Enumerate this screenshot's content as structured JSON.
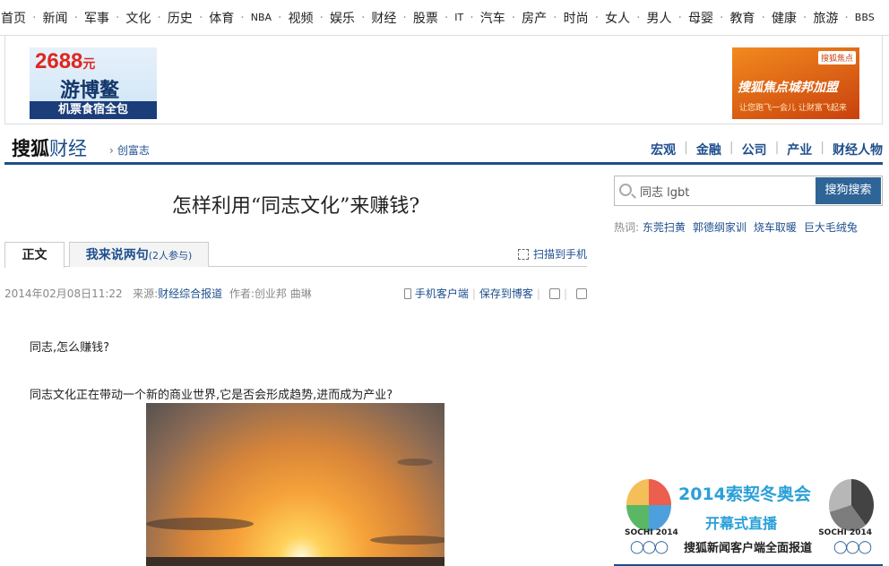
{
  "top_nav": [
    "首页",
    "新闻",
    "军事",
    "文化",
    "历史",
    "体育",
    "NBA",
    "视频",
    "娱乐",
    "财经",
    "股票",
    "IT",
    "汽车",
    "房产",
    "时尚",
    "女人",
    "男人",
    "母婴",
    "教育",
    "健康",
    "旅游",
    "BBS"
  ],
  "ads": {
    "left": {
      "price": "2688",
      "unit": "元",
      "name": "游博鳌",
      "strip": "机票食宿全包"
    },
    "right": {
      "logo": "搜狐焦点",
      "slogan": "搜狐焦点城邦加盟",
      "sub": "让您跑飞一会儿 让财富飞起来"
    }
  },
  "channel": {
    "brand_main": "搜狐",
    "brand_accent": "财经",
    "crumb_chevron": "›",
    "crumb": "创富志",
    "menu": [
      "宏观",
      "金融",
      "公司",
      "产业",
      "财经人物"
    ]
  },
  "article": {
    "title": "怎样利用“同志文化”来赚钱?",
    "tab_active": "正文",
    "tab_comment": "我来说两句",
    "tab_comment_count": "(2人参与)",
    "scan": "扫描到手机",
    "date": "2014年02月08日11:22",
    "source_label": "来源:",
    "source": "财经综合报道",
    "author_label": "作者:",
    "author": "创业邦 曲琳",
    "tool_mobile": "手机客户端",
    "tool_blog": "保存到博客",
    "para1": "同志,怎么赚钱?",
    "para2": "同志文化正在带动一个新的商业世界,它是否会形成趋势,进而成为产业?"
  },
  "sidebar": {
    "search_value": "同志 lgbt",
    "search_button": "搜狗搜索",
    "hot_label": "热词:",
    "hot_words": [
      "东莞扫黄",
      "郭德纲家训",
      "烧车取暖",
      "巨大毛绒兔"
    ],
    "sochi": {
      "headline": "2014索契冬奥会",
      "live": "开幕式直播",
      "footer": "搜狐新闻客户端全面报道",
      "badge_left": "SOCHI 2014",
      "badge_right": "SOCHI 2014"
    }
  },
  "colors": {
    "brand_blue": "#1e4f8c",
    "search_button": "#2f6497",
    "ad_red": "#e0261e"
  }
}
